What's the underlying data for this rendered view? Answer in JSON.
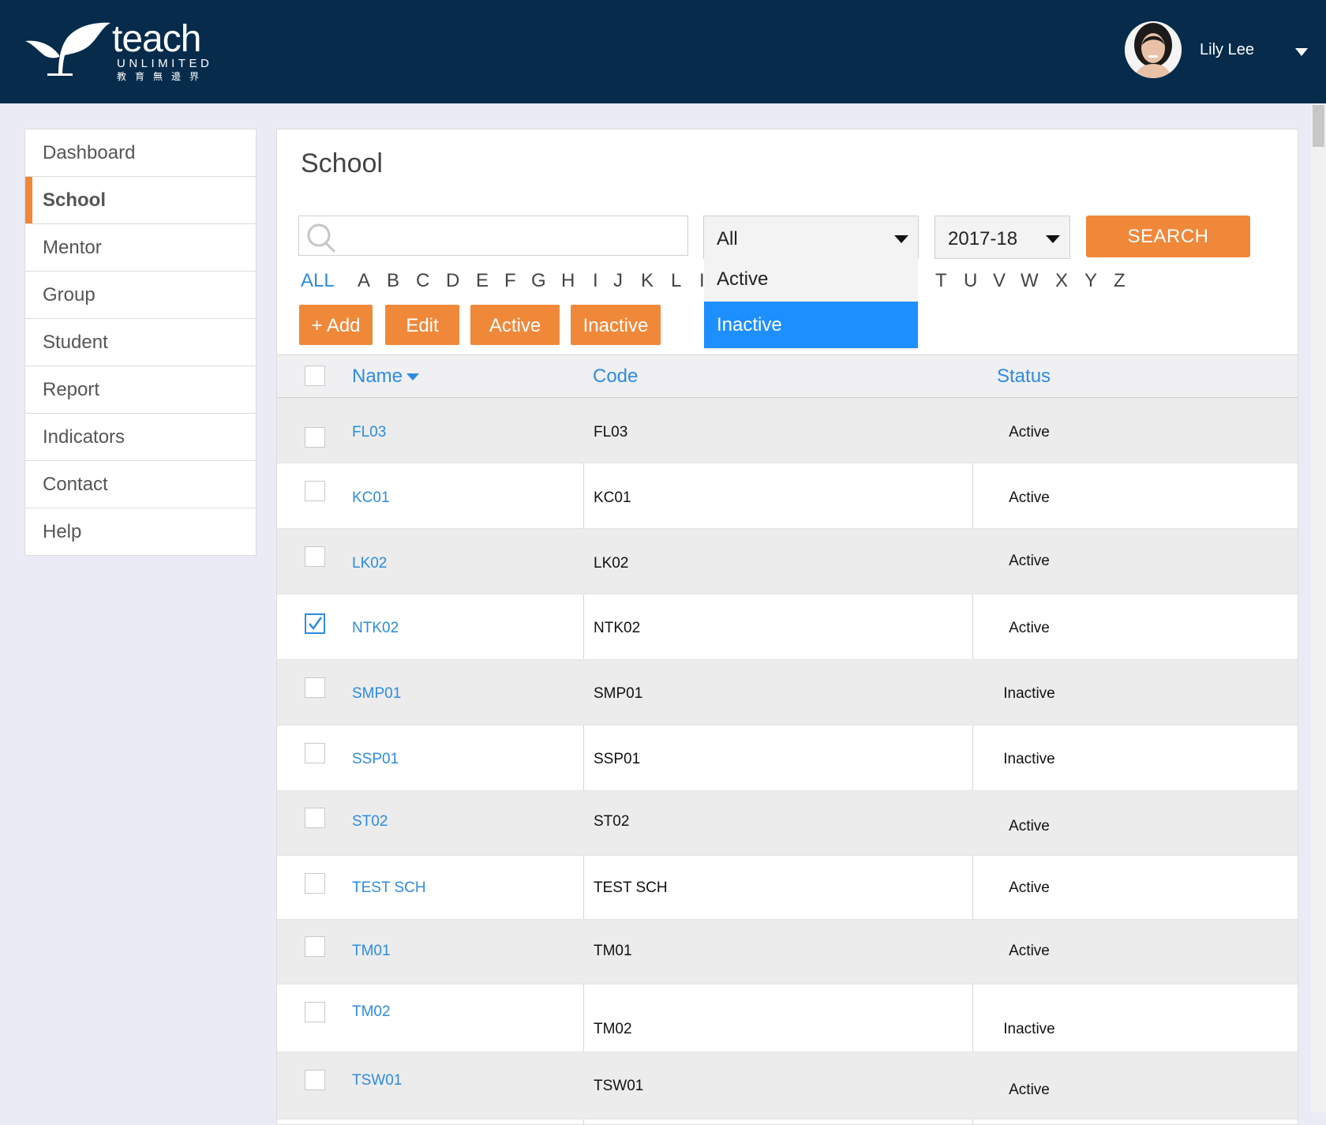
{
  "header": {
    "brand_word": "teach",
    "brand_sub": "UNLIMITED",
    "brand_cn": "教育無邊界",
    "user_name": "Lily Lee"
  },
  "sidebar": {
    "items": [
      {
        "label": "Dashboard",
        "active": false
      },
      {
        "label": "School",
        "active": true
      },
      {
        "label": "Mentor",
        "active": false
      },
      {
        "label": "Group",
        "active": false
      },
      {
        "label": "Student",
        "active": false
      },
      {
        "label": "Report",
        "active": false
      },
      {
        "label": "Indicators",
        "active": false
      },
      {
        "label": "Contact",
        "active": false
      },
      {
        "label": "Help",
        "active": false
      }
    ]
  },
  "main": {
    "title": "School",
    "search": {
      "placeholder": "",
      "value": ""
    },
    "status_filter": {
      "selected": "All",
      "options": [
        "Active",
        "Inactive"
      ],
      "highlighted": "Inactive"
    },
    "year_filter": {
      "selected": "2017-18"
    },
    "search_button": "SEARCH",
    "alphabet": {
      "all_label": "ALL",
      "left_letters": [
        "A",
        "B",
        "C",
        "D",
        "E",
        "F",
        "G",
        "H",
        "I",
        "J",
        "K",
        "L",
        "I"
      ],
      "right_letters": [
        "T",
        "U",
        "V",
        "W",
        "X",
        "Y",
        "Z"
      ]
    },
    "actions": {
      "add": "+ Add",
      "edit": "Edit",
      "active": "Active",
      "inactive": "Inactive"
    }
  },
  "table": {
    "headers": {
      "name": "Name",
      "code": "Code",
      "status": "Status"
    },
    "rows": [
      {
        "name": "FL03",
        "code": "FL03",
        "status": "Active",
        "checked": false
      },
      {
        "name": "KC01",
        "code": "KC01",
        "status": "Active",
        "checked": false
      },
      {
        "name": "LK02",
        "code": "LK02",
        "status": "Active",
        "checked": false
      },
      {
        "name": "NTK02",
        "code": "NTK02",
        "status": "Active",
        "checked": true
      },
      {
        "name": "SMP01",
        "code": "SMP01",
        "status": "Inactive",
        "checked": false
      },
      {
        "name": "SSP01",
        "code": "SSP01",
        "status": "Inactive",
        "checked": false
      },
      {
        "name": "ST02",
        "code": "ST02",
        "status": "Active",
        "checked": false
      },
      {
        "name": "TEST SCH",
        "code": "TEST SCH",
        "status": "Active",
        "checked": false
      },
      {
        "name": "TM01",
        "code": "TM01",
        "status": "Active",
        "checked": false
      },
      {
        "name": "TM02",
        "code": "TM02",
        "status": "Inactive",
        "checked": false
      },
      {
        "name": "TSW01",
        "code": "TSW01",
        "status": "Active",
        "checked": false
      }
    ]
  },
  "colors": {
    "header_bg": "#062b4b",
    "accent_orange": "#f0883a",
    "link_blue": "#2d8be0",
    "dropdown_highlight": "#1e8fff"
  }
}
